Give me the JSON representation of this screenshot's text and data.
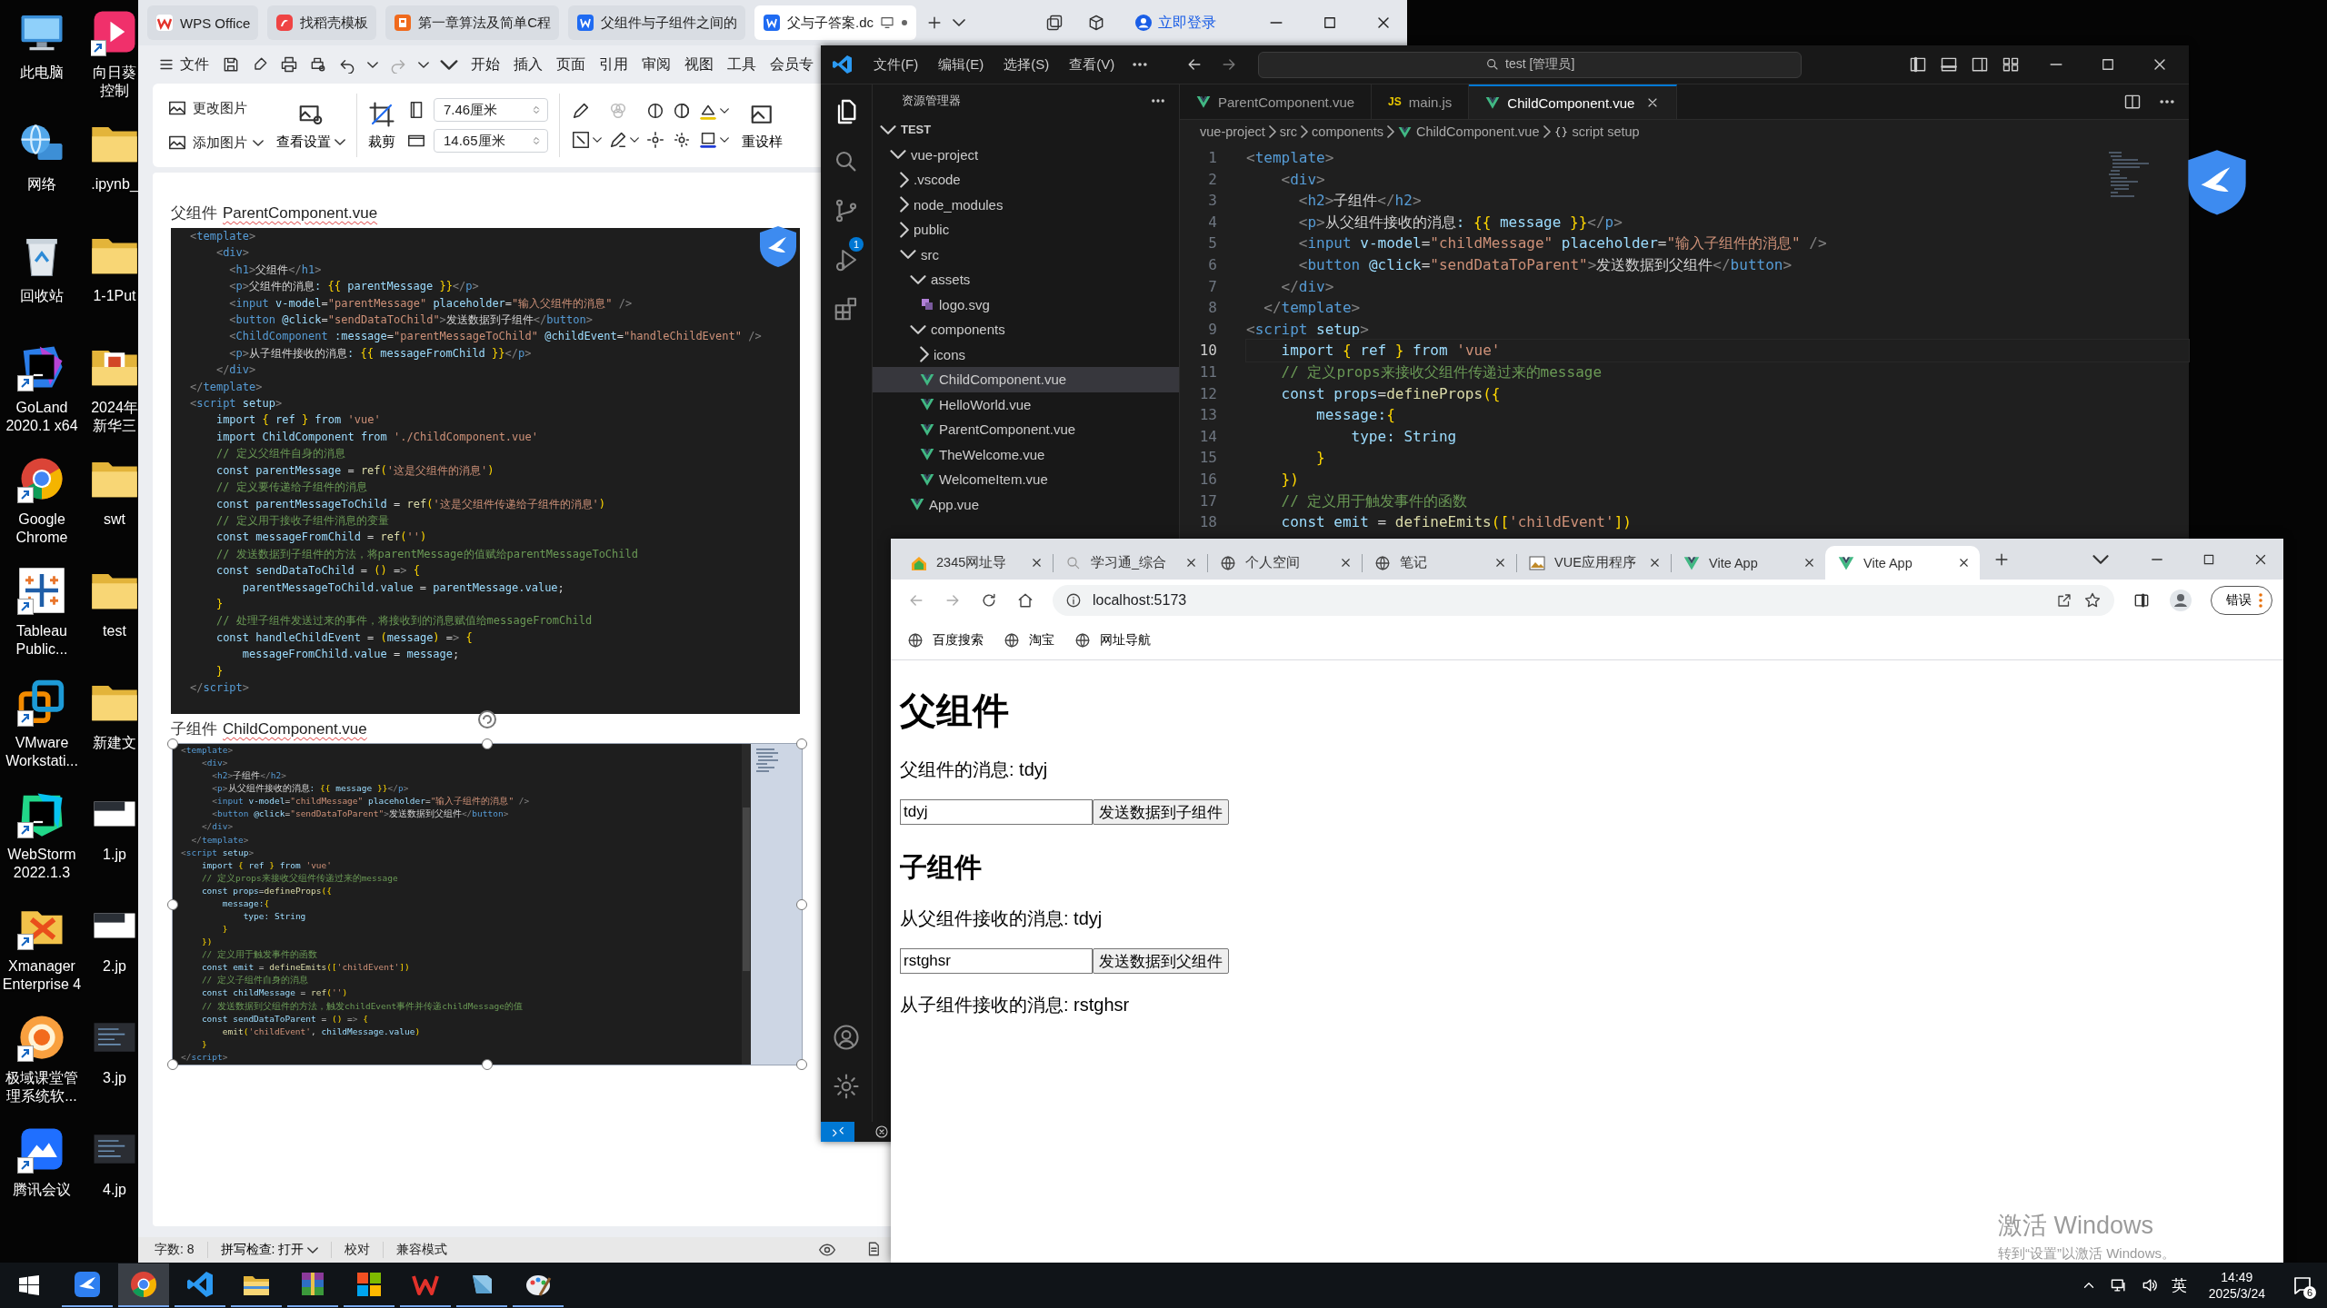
{
  "desktop": {
    "icons": [
      {
        "label": [
          "此电脑"
        ],
        "kind": "computer",
        "shortcut": false
      },
      {
        "label": [
          "网络"
        ],
        "kind": "network",
        "shortcut": false
      },
      {
        "label": [
          "回收站"
        ],
        "kind": "recycle",
        "shortcut": false
      },
      {
        "label": [
          "GoLand",
          "2020.1 x64"
        ],
        "kind": "goland",
        "shortcut": true
      },
      {
        "label": [
          "Google",
          "Chrome"
        ],
        "kind": "chrome",
        "shortcut": true
      },
      {
        "label": [
          "Tableau",
          "Public..."
        ],
        "kind": "tableau",
        "shortcut": true
      },
      {
        "label": [
          "VMware",
          "Workstati..."
        ],
        "kind": "vmware",
        "shortcut": true
      },
      {
        "label": [
          "WebStorm",
          "2022.1.3"
        ],
        "kind": "webstorm",
        "shortcut": true
      },
      {
        "label": [
          "Xmanager",
          "Enterprise 4"
        ],
        "kind": "xmanager",
        "shortcut": true
      },
      {
        "label": [
          "极域课堂管",
          "理系统软..."
        ],
        "kind": "classroom",
        "shortcut": true
      },
      {
        "label": [
          "腾讯会议"
        ],
        "kind": "meeting",
        "shortcut": true
      }
    ],
    "icons_column_2": [
      {
        "label": [
          "向日葵",
          "控制"
        ],
        "kind": "sunlogin",
        "shortcut": true
      },
      {
        "label": [
          ".ipynb_"
        ],
        "kind": "folder",
        "shortcut": false
      },
      {
        "label": [
          "1-1Put"
        ],
        "kind": "folder",
        "shortcut": false
      },
      {
        "label": [
          "2024年",
          "新华三"
        ],
        "kind": "ppt-folder",
        "shortcut": false
      },
      {
        "label": [
          "swt"
        ],
        "kind": "folder",
        "shortcut": false
      },
      {
        "label": [
          "test"
        ],
        "kind": "folder",
        "shortcut": false
      },
      {
        "label": [
          "新建文"
        ],
        "kind": "folder",
        "shortcut": false
      },
      {
        "label": [
          "1.jp"
        ],
        "kind": "image",
        "shortcut": false
      },
      {
        "label": [
          "2.jp"
        ],
        "kind": "image",
        "shortcut": false
      },
      {
        "label": [
          "3.jp"
        ],
        "kind": "code-image",
        "shortcut": false
      },
      {
        "label": [
          "4.jp"
        ],
        "kind": "code-image",
        "shortcut": false
      }
    ],
    "activation": {
      "title": "激活 Windows",
      "subtitle": "转到“设置”以激活 Windows。"
    }
  },
  "wps": {
    "tabs": [
      {
        "label": "WPS Office",
        "kind": "wps",
        "selected": false
      },
      {
        "label": "找稻壳模板",
        "kind": "docer",
        "selected": false
      },
      {
        "label": "第一章算法及简单C程",
        "kind": "ppt",
        "selected": false
      },
      {
        "label": "父组件与子组件之间的",
        "kind": "doc",
        "selected": false
      },
      {
        "label": "父与子答案.dc",
        "kind": "doc",
        "selected": true
      }
    ],
    "login": "立即登录",
    "file_menu": "文件",
    "menu": [
      "开始",
      "插入",
      "页面",
      "引用",
      "审阅",
      "视图",
      "工具",
      "会员专"
    ],
    "ribbon": {
      "change_picture": "更改图片",
      "add_picture": "添加图片",
      "view_settings": "查看设置",
      "crop": "裁剪",
      "height": "7.46厘米",
      "width": "14.65厘米",
      "reset_style": "重设样"
    },
    "document": {
      "sections": [
        {
          "title": "父组件",
          "file": "ParentComponent.vue",
          "selected": false,
          "code": [
            "<template>",
            "    <div>",
            "      <h1>父组件</h1>",
            "      <p>父组件的消息: {{ parentMessage }}</p>",
            "      <input v-model=\"parentMessage\" placeholder=\"输入父组件的消息\" />",
            "      <button @click=\"sendDataToChild\">发送数据到子组件</button>",
            "      <ChildComponent :message=\"parentMessageToChild\" @childEvent=\"handleChildEvent\" />",
            "      <p>从子组件接收的消息: {{ messageFromChild }}</p>",
            "    </div>",
            "</template>",
            "<script setup>",
            "    import { ref } from 'vue'",
            "    import ChildComponent from './ChildComponent.vue'",
            "    // 定义父组件自身的消息",
            "    const parentMessage = ref('这是父组件的消息')",
            "    // 定义要传递给子组件的消息",
            "    const parentMessageToChild = ref('这是父组件传递给子组件的消息')",
            "    // 定义用于接收子组件消息的变量",
            "    const messageFromChild = ref('')",
            "    // 发送数据到子组件的方法，将parentMessage的值赋给parentMessageToChild",
            "    const sendDataToChild = () => {",
            "        parentMessageToChild.value = parentMessage.value;",
            "    }",
            "    // 处理子组件发送过来的事件，将接收到的消息赋值给messageFromChild",
            "    const handleChildEvent = (message) => {",
            "        messageFromChild.value = message;",
            "    }",
            "</script>"
          ]
        },
        {
          "title": "子组件",
          "file": "ChildComponent.vue",
          "selected": true,
          "code": [
            "<template>",
            "    <div>",
            "      <h2>子组件</h2>",
            "      <p>从父组件接收的消息: {{ message }}</p>",
            "      <input v-model=\"childMessage\" placeholder=\"输入子组件的消息\" />",
            "      <button @click=\"sendDataToParent\">发送数据到父组件</button>",
            "    </div>",
            "  </template>",
            "<script setup>",
            "    import { ref } from 'vue'",
            "    // 定义props来接收父组件传递过来的message",
            "    const props=defineProps({",
            "        message:{",
            "            type: String",
            "        }",
            "    })",
            "    // 定义用于触发事件的函数",
            "    const emit = defineEmits(['childEvent'])",
            "    // 定义子组件自身的消息",
            "    const childMessage = ref('')",
            "    // 发送数据到父组件的方法，触发childEvent事件并传递childMessage的值",
            "    const sendDataToParent = () => {",
            "        emit('childEvent', childMessage.value)",
            "    }",
            "</script>"
          ]
        }
      ]
    },
    "status_bar": {
      "word_count": "字数: 8",
      "spell_check": "拼写检查: 打开",
      "proofread": "校对",
      "compat": "兼容模式"
    }
  },
  "vscode": {
    "menu": [
      "文件(F)",
      "编辑(E)",
      "选择(S)",
      "查看(V)"
    ],
    "search": "test [管理员]",
    "extensions_badge": "1",
    "explorer_title": "资源管理器",
    "tree": {
      "label": "TEST",
      "kind": "folder",
      "expanded": true,
      "selected": false,
      "children": [
        {
          "label": "vue-project",
          "kind": "folder",
          "expanded": true,
          "selected": false,
          "children": [
            {
              "label": ".vscode",
              "kind": "folder",
              "expanded": false,
              "selected": false
            },
            {
              "label": "node_modules",
              "kind": "folder",
              "expanded": false,
              "selected": false
            },
            {
              "label": "public",
              "kind": "folder",
              "expanded": false,
              "selected": false
            },
            {
              "label": "src",
              "kind": "folder",
              "expanded": true,
              "selected": false,
              "children": [
                {
                  "label": "assets",
                  "kind": "folder",
                  "expanded": true,
                  "selected": false,
                  "children": [
                    {
                      "label": "logo.svg",
                      "kind": "svg",
                      "selected": false
                    }
                  ]
                },
                {
                  "label": "components",
                  "kind": "folder",
                  "expanded": true,
                  "selected": false,
                  "children": [
                    {
                      "label": "icons",
                      "kind": "folder",
                      "expanded": false,
                      "selected": false
                    },
                    {
                      "label": "ChildComponent.vue",
                      "kind": "vue",
                      "selected": true
                    },
                    {
                      "label": "HelloWorld.vue",
                      "kind": "vue",
                      "selected": false
                    },
                    {
                      "label": "ParentComponent.vue",
                      "kind": "vue",
                      "selected": false
                    },
                    {
                      "label": "TheWelcome.vue",
                      "kind": "vue",
                      "selected": false
                    },
                    {
                      "label": "WelcomeItem.vue",
                      "kind": "vue",
                      "selected": false
                    }
                  ]
                },
                {
                  "label": "App.vue",
                  "kind": "vue",
                  "selected": false
                }
              ]
            }
          ]
        }
      ]
    },
    "tabs": [
      {
        "label": "ParentComponent.vue",
        "kind": "vue",
        "selected": false
      },
      {
        "label": "main.js",
        "kind": "js",
        "icon_text": "JS",
        "selected": false
      },
      {
        "label": "ChildComponent.vue",
        "kind": "vue",
        "selected": true
      }
    ],
    "breadcrumb": [
      "vue-project",
      "src",
      "components",
      "ChildComponent.vue",
      "script setup"
    ],
    "editor": {
      "lines": [
        {
          "number": "1",
          "text": "<template>",
          "current": false
        },
        {
          "number": "2",
          "text": "    <div>",
          "current": false
        },
        {
          "number": "3",
          "text": "      <h2>子组件</h2>",
          "current": false
        },
        {
          "number": "4",
          "text": "      <p>从父组件接收的消息: {{ message }}</p>",
          "current": false
        },
        {
          "number": "5",
          "text": "      <input v-model=\"childMessage\" placeholder=\"输入子组件的消息\" />",
          "current": false
        },
        {
          "number": "6",
          "text": "      <button @click=\"sendDataToParent\">发送数据到父组件</button>",
          "current": false
        },
        {
          "number": "7",
          "text": "    </div>",
          "current": false
        },
        {
          "number": "8",
          "text": "  </template>",
          "current": false
        },
        {
          "number": "9",
          "text": "<script setup>",
          "current": false
        },
        {
          "number": "10",
          "text": "    import { ref } from 'vue'",
          "current": true
        },
        {
          "number": "11",
          "text": "    // 定义props来接收父组件传递过来的message",
          "current": false
        },
        {
          "number": "12",
          "text": "    const props=defineProps({",
          "current": false
        },
        {
          "number": "13",
          "text": "        message:{",
          "current": false
        },
        {
          "number": "14",
          "text": "            type: String",
          "current": false
        },
        {
          "number": "15",
          "text": "        }",
          "current": false
        },
        {
          "number": "16",
          "text": "    })",
          "current": false
        },
        {
          "number": "17",
          "text": "    // 定义用于触发事件的函数",
          "current": false
        },
        {
          "number": "18",
          "text": "    const emit = defineEmits(['childEvent'])",
          "current": false
        }
      ]
    }
  },
  "browser": {
    "tabs": [
      {
        "label": "2345网址导",
        "kind": "site",
        "selected": false
      },
      {
        "label": "学习通_综合",
        "kind": "search",
        "selected": false
      },
      {
        "label": "个人空间",
        "kind": "globe",
        "selected": false
      },
      {
        "label": "笔记",
        "kind": "globe",
        "selected": false
      },
      {
        "label": "VUE应用程序",
        "kind": "image",
        "selected": false
      },
      {
        "label": "Vite App",
        "kind": "vue",
        "selected": false
      },
      {
        "label": "Vite App",
        "kind": "vue",
        "selected": true
      }
    ],
    "url": "localhost:5173",
    "profile_button": "错误",
    "bookmarks": [
      "百度搜索",
      "淘宝",
      "网址导航"
    ],
    "page": {
      "parent_heading": "父组件",
      "parent_message": "父组件的消息: tdyj",
      "parent_input": "tdyj",
      "parent_button": "发送数据到子组件",
      "child_heading": "子组件",
      "child_received": "从父组件接收的消息: tdyj",
      "child_input": "rstghsr",
      "child_button": "发送数据到父组件",
      "parent_received": "从子组件接收的消息: rstghsr"
    }
  },
  "taskbar": {
    "apps": [
      {
        "kind": "bird",
        "selected": false
      },
      {
        "kind": "chrome",
        "selected": true
      },
      {
        "kind": "vscode",
        "selected": false
      },
      {
        "kind": "explorer",
        "selected": false
      },
      {
        "kind": "winrar",
        "selected": false
      },
      {
        "kind": "office",
        "selected": false
      },
      {
        "kind": "wps",
        "selected": false
      },
      {
        "kind": "notes",
        "selected": false
      },
      {
        "kind": "paint",
        "selected": false
      }
    ],
    "ime": "英",
    "time": "14:49",
    "date": "2025/3/24",
    "notifications": "6"
  }
}
